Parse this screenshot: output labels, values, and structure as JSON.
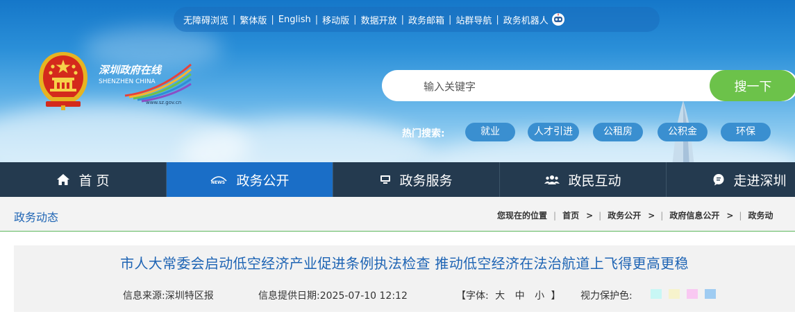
{
  "top_links": [
    {
      "label": "无障碍浏览"
    },
    {
      "label": "繁体版"
    },
    {
      "label": "English"
    },
    {
      "label": "移动版"
    },
    {
      "label": "数据开放"
    },
    {
      "label": "政务邮箱"
    },
    {
      "label": "站群导航"
    },
    {
      "label": "政务机器人"
    }
  ],
  "logo": {
    "text_cn": "深圳政府在线",
    "text_en": "SHENZHEN CHINA",
    "url_text": "www.sz.gov.cn"
  },
  "search": {
    "placeholder": "输入关键字",
    "button_label": "搜一下"
  },
  "hot_search": {
    "label": "热门搜索:",
    "tags": [
      {
        "label": "就业"
      },
      {
        "label": "人才引进"
      },
      {
        "label": "公租房"
      },
      {
        "label": "公积金"
      },
      {
        "label": "环保"
      }
    ]
  },
  "main_nav": [
    {
      "label": "首 页",
      "icon": "home-icon"
    },
    {
      "label": "政务公开",
      "icon": "news-icon",
      "active": true
    },
    {
      "label": "政务服务",
      "icon": "monitor-icon"
    },
    {
      "label": "政民互动",
      "icon": "people-icon"
    },
    {
      "label": "走进深圳",
      "icon": "chat-icon"
    }
  ],
  "section_title": "政务动态",
  "breadcrumb": {
    "prefix": "您现在的位置",
    "items": [
      {
        "label": "首页"
      },
      {
        "label": "政务公开"
      },
      {
        "label": "政府信息公开"
      },
      {
        "label": "政务动"
      }
    ]
  },
  "article": {
    "title": "市人大常委会启动低空经济产业促进条例执法检查 推动低空经济在法治航道上飞得更高更稳",
    "source_label": "信息来源:深圳特区报",
    "date_label": "信息提供日期:2025-07-10 12:12",
    "font_label": "【字体:",
    "font_sizes": [
      "大",
      "中",
      "小"
    ],
    "font_close": "】",
    "eye_label": "视力保护色:",
    "eye_colors": [
      "#c8f7f5",
      "#f7f3cc",
      "#f9c8f2",
      "#9fccf2"
    ]
  },
  "colors": {
    "accent": "#1a6ec7",
    "nav_bg": "#243a4f",
    "search_btn": "#6cc24a",
    "title_blue": "#1e64b4"
  }
}
